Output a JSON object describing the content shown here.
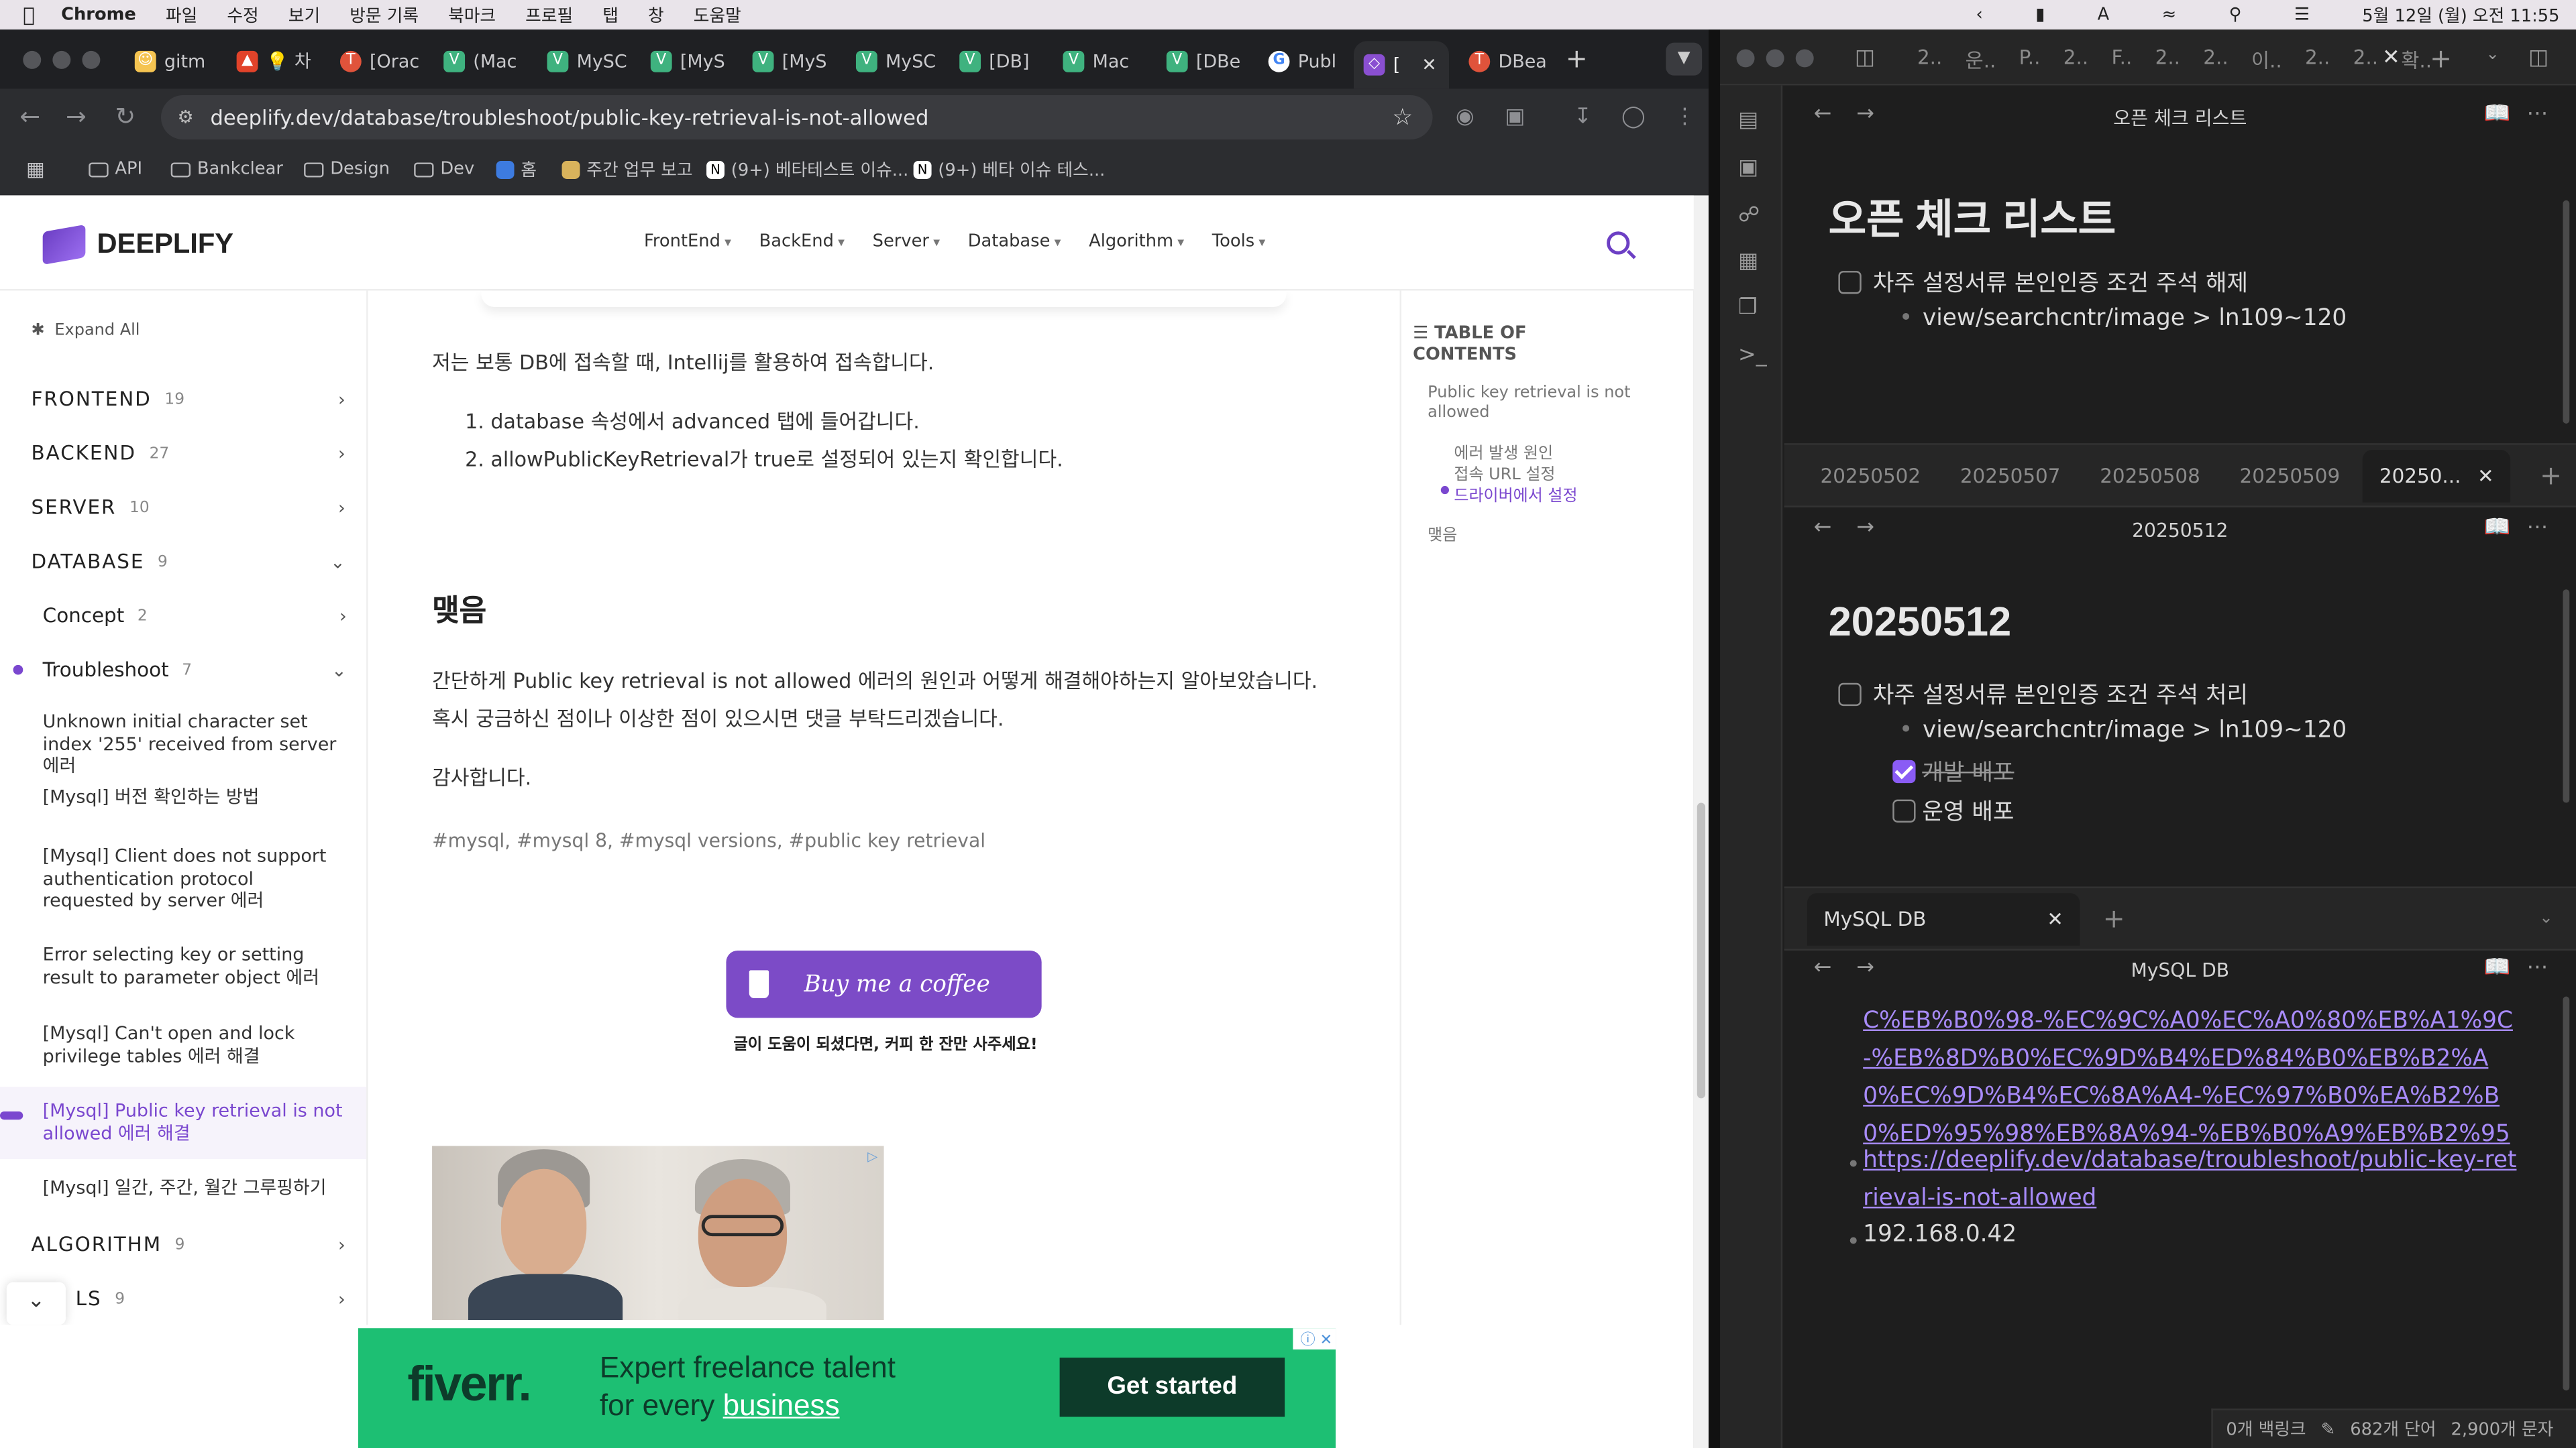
{
  "menubar": {
    "app": "Chrome",
    "items": [
      "파일",
      "수정",
      "보기",
      "방문 기록",
      "북마크",
      "프로필",
      "탭",
      "창",
      "도움말"
    ],
    "date": "5월 12일 (월) 오전 11:55"
  },
  "browser": {
    "tabs": [
      {
        "label": "gitm",
        "icon": "gitmoji-icon"
      },
      {
        "label": "💡 차",
        "icon": "gitlab-icon"
      },
      {
        "label": "[Orac",
        "icon": "red-circle-icon"
      },
      {
        "label": "(Mac",
        "icon": "vuepress-icon"
      },
      {
        "label": "MySC",
        "icon": "vuepress-icon"
      },
      {
        "label": "[MyS",
        "icon": "vuepress-icon"
      },
      {
        "label": "[MyS",
        "icon": "vuepress-icon"
      },
      {
        "label": "MySC",
        "icon": "vuepress-icon"
      },
      {
        "label": "[DB]",
        "icon": "vuepress-icon"
      },
      {
        "label": "Mac",
        "icon": "vuepress-icon"
      },
      {
        "label": "[DBe",
        "icon": "vuepress-icon"
      },
      {
        "label": "Publ",
        "icon": "google-icon"
      },
      {
        "label": "[",
        "icon": "deeplify-icon",
        "active": true
      },
      {
        "label": "DBea",
        "icon": "red-circle-icon"
      }
    ],
    "url": "deeplify.dev/database/troubleshoot/public-key-retrieval-is-not-allowed",
    "bookmarks": [
      "API",
      "Bankclear",
      "Design",
      "Dev",
      "홈",
      "주간 업무 보고",
      "(9+) 베타테스트 이슈...",
      "(9+) 베타 이슈 테스..."
    ]
  },
  "site": {
    "logo": "DEEPLIFY",
    "nav": [
      "FrontEnd",
      "BackEnd",
      "Server",
      "Database",
      "Algorithm",
      "Tools"
    ],
    "expand_all": "Expand All",
    "sidebar": [
      {
        "label": "FRONTEND",
        "count": "19"
      },
      {
        "label": "BACKEND",
        "count": "27"
      },
      {
        "label": "SERVER",
        "count": "10"
      },
      {
        "label": "DATABASE",
        "count": "9"
      }
    ],
    "database_children": [
      {
        "label": "Concept",
        "count": "2"
      },
      {
        "label": "Troubleshoot",
        "count": "7"
      }
    ],
    "troubleshoot_items": [
      "Unknown initial character set index '255' received from server 에러",
      "[Mysql] 버전 확인하는 방법",
      "[Mysql] Client does not support authentication protocol requested by server 에러",
      "Error selecting key or setting result to parameter object 에러",
      "[Mysql] Can't open and lock privilege tables 에러 해결",
      "[Mysql] Public key retrieval is not allowed 에러 해결",
      "[Mysql] 일간, 주간, 월간 그루핑하기"
    ],
    "sidebar_bottom": [
      {
        "label": "ALGORITHM",
        "count": "9"
      },
      {
        "label": "LS",
        "count": "9"
      }
    ],
    "content": {
      "intro": "저는 보통 DB에 접속할 때, Intellij를 활용하여 접속합니다.",
      "steps": [
        "database 속성에서 advanced 탭에 들어갑니다.",
        "allowPublicKeyRetrieval가 true로 설정되어 있는지 확인합니다."
      ],
      "heading": "맺음",
      "summary": "간단하게 Public key retrieval is not allowed 에러의 원인과 어떻게 해결해야하는지 알아보았습니다. 혹시 궁금하신 점이나 이상한 점이 있으시면 댓글 부탁드리겠습니다.",
      "thanks": "감사합니다.",
      "tags": "#mysql, #mysql 8, #mysql versions, #public key retrieval",
      "coffee": "Buy me a coffee",
      "coffee_caption": "글이 도움이 되셨다면, 커피 한 잔만 사주세요!"
    },
    "toc": {
      "title": "TABLE OF CONTENTS",
      "items": [
        "Public key retrieval is not allowed",
        "에러 발생 원인",
        "접속 URL 설정",
        "드라이버에서 설정",
        "맺음"
      ]
    },
    "ad": {
      "brand": "fiverr.",
      "line1": "Expert freelance talent",
      "line2a": "for every ",
      "line2b": "business",
      "cta": "Get started"
    }
  },
  "obsidian": {
    "top_tabs": [
      "2..",
      "운..",
      "P..",
      "2..",
      "F..",
      "2..",
      "2..",
      "이..",
      "2..",
      "2..",
      "확.."
    ],
    "pane1": {
      "header": "오픈 체크 리스트",
      "title": "오픈 체크 리스트",
      "task": "차주 설정서류 본인인증 조건 주석 해제",
      "bullet": "view/searchcntr/image > ln109~120"
    },
    "pane2": {
      "tabs": [
        "20250502",
        "20250507",
        "20250508",
        "20250509",
        "20250..."
      ],
      "header": "20250512",
      "title": "20250512",
      "task": "차주 설정서류 본인인증 조건 주석 처리",
      "bullet": "view/searchcntr/image > ln109~120",
      "sub1": "개발 배포",
      "sub2": "운영 배포"
    },
    "pane3": {
      "tab": "MySQL DB",
      "header": "MySQL DB",
      "link1": "C%EB%B0%98-%EC%9C%A0%EC%A0%80%EB%A1%9C-%EB%8D%B0%EC%9D%B4%ED%84%B0%EB%B2%A0%EC%9D%B4%EC%8A%A4-%EC%97%B0%EA%B2%B0%ED%95%98%EB%8A%94-%EB%B0%A9%EB%B2%95",
      "link2": "https://deeplify.dev/database/troubleshoot/public-key-retrieval-is-not-allowed",
      "ip": "192.168.0.42"
    },
    "status": {
      "backlinks": "0개 백링크",
      "words": "682개 단어",
      "chars": "2,900개 문자"
    }
  }
}
